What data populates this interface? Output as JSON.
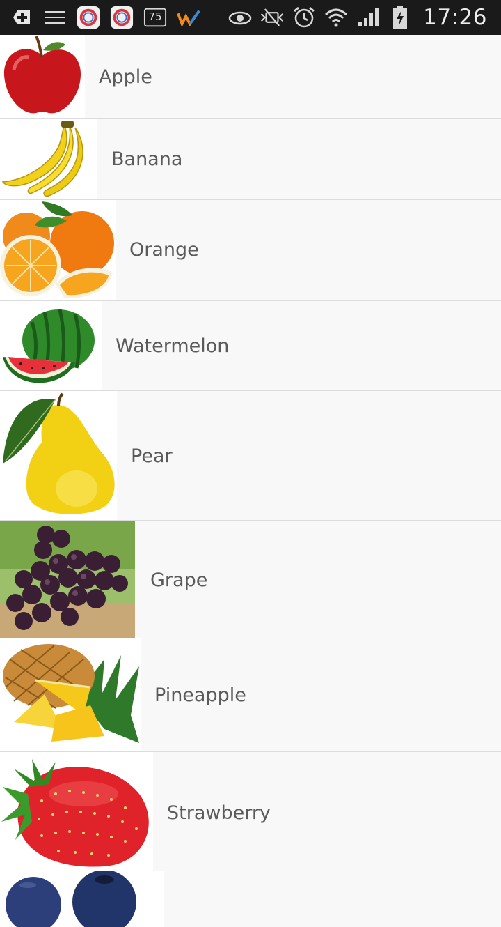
{
  "status_bar": {
    "time": "17:26",
    "badge_number": "75",
    "icons": [
      "add-icon",
      "menu-lines-icon",
      "app-ring-icon",
      "app-ring-icon",
      "count-badge-icon",
      "w-check-icon",
      "eye-icon",
      "mute-icon",
      "alarm-icon",
      "wifi-icon",
      "signal-icon",
      "battery-charging-icon"
    ]
  },
  "fruits": [
    {
      "name": "Apple",
      "icon": "apple-image"
    },
    {
      "name": "Banana",
      "icon": "banana-image"
    },
    {
      "name": "Orange",
      "icon": "orange-image"
    },
    {
      "name": "Watermelon",
      "icon": "watermelon-image"
    },
    {
      "name": "Pear",
      "icon": "pear-image"
    },
    {
      "name": "Grape",
      "icon": "grape-image"
    },
    {
      "name": "Pineapple",
      "icon": "pineapple-image"
    },
    {
      "name": "Strawberry",
      "icon": "strawberry-image"
    },
    {
      "name": "",
      "icon": "blueberry-image"
    }
  ],
  "colors": {
    "background": "#f8f8f8",
    "divider": "#dcdcdc",
    "label": "#5a5a5a",
    "statusbar": "#1a1a1a"
  }
}
